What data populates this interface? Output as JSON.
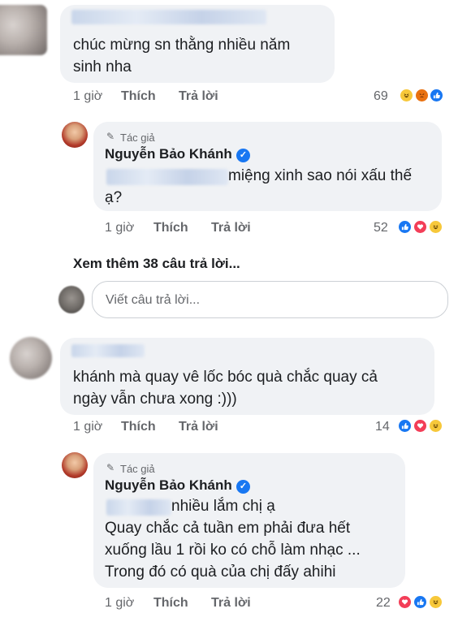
{
  "comments": [
    {
      "text_lines": [
        "chúc mừng sn thằng nhiều năm",
        "sinh nha"
      ],
      "time": "1 giờ",
      "like": "Thích",
      "reply": "Trả lời",
      "reaction_count": "69",
      "reactions": [
        "haha-icon",
        "angry-icon",
        "like-icon"
      ]
    },
    {
      "text_lines": [
        "khánh mà quay vê lốc bóc quà chắc quay cả",
        "ngày vẫn chưa xong :)))"
      ],
      "time": "1 giờ",
      "like": "Thích",
      "reply": "Trả lời",
      "reaction_count": "14",
      "reactions": [
        "like-icon",
        "love-icon",
        "haha-icon"
      ]
    }
  ],
  "replies": [
    {
      "badge": "Tác giả",
      "author": "Nguyễn Bảo Khánh",
      "text_lines": [
        "miệng xinh sao nói xấu thế",
        "ạ?"
      ],
      "time": "1 giờ",
      "like": "Thích",
      "reply": "Trả lời",
      "reaction_count": "52",
      "reactions": [
        "like-icon",
        "love-icon",
        "haha-icon"
      ]
    },
    {
      "badge": "Tác giả",
      "author": "Nguyễn Bảo Khánh",
      "text_lines": [
        "nhiều lắm chị ạ",
        "Quay chắc cả tuần em phải đưa hết",
        "xuống lầu 1 rồi ko có chỗ làm nhạc ...",
        "Trong đó có quà của chị đấy ahihi"
      ],
      "time": "1 giờ",
      "like": "Thích",
      "reply": "Trả lời",
      "reaction_count": "22",
      "reactions": [
        "love-icon",
        "like-icon",
        "haha-icon"
      ]
    }
  ],
  "see_more": "Xem thêm 38 câu trả lời...",
  "reply_input": {
    "placeholder": "Viết câu trả lời..."
  },
  "colors": {
    "bubble": "#f0f2f5",
    "meta_text": "#65676b",
    "like_blue": "#1877f2",
    "love_red": "#f33e58",
    "haha_yellow": "#f7c83a",
    "angry_orange": "#e9710f"
  }
}
